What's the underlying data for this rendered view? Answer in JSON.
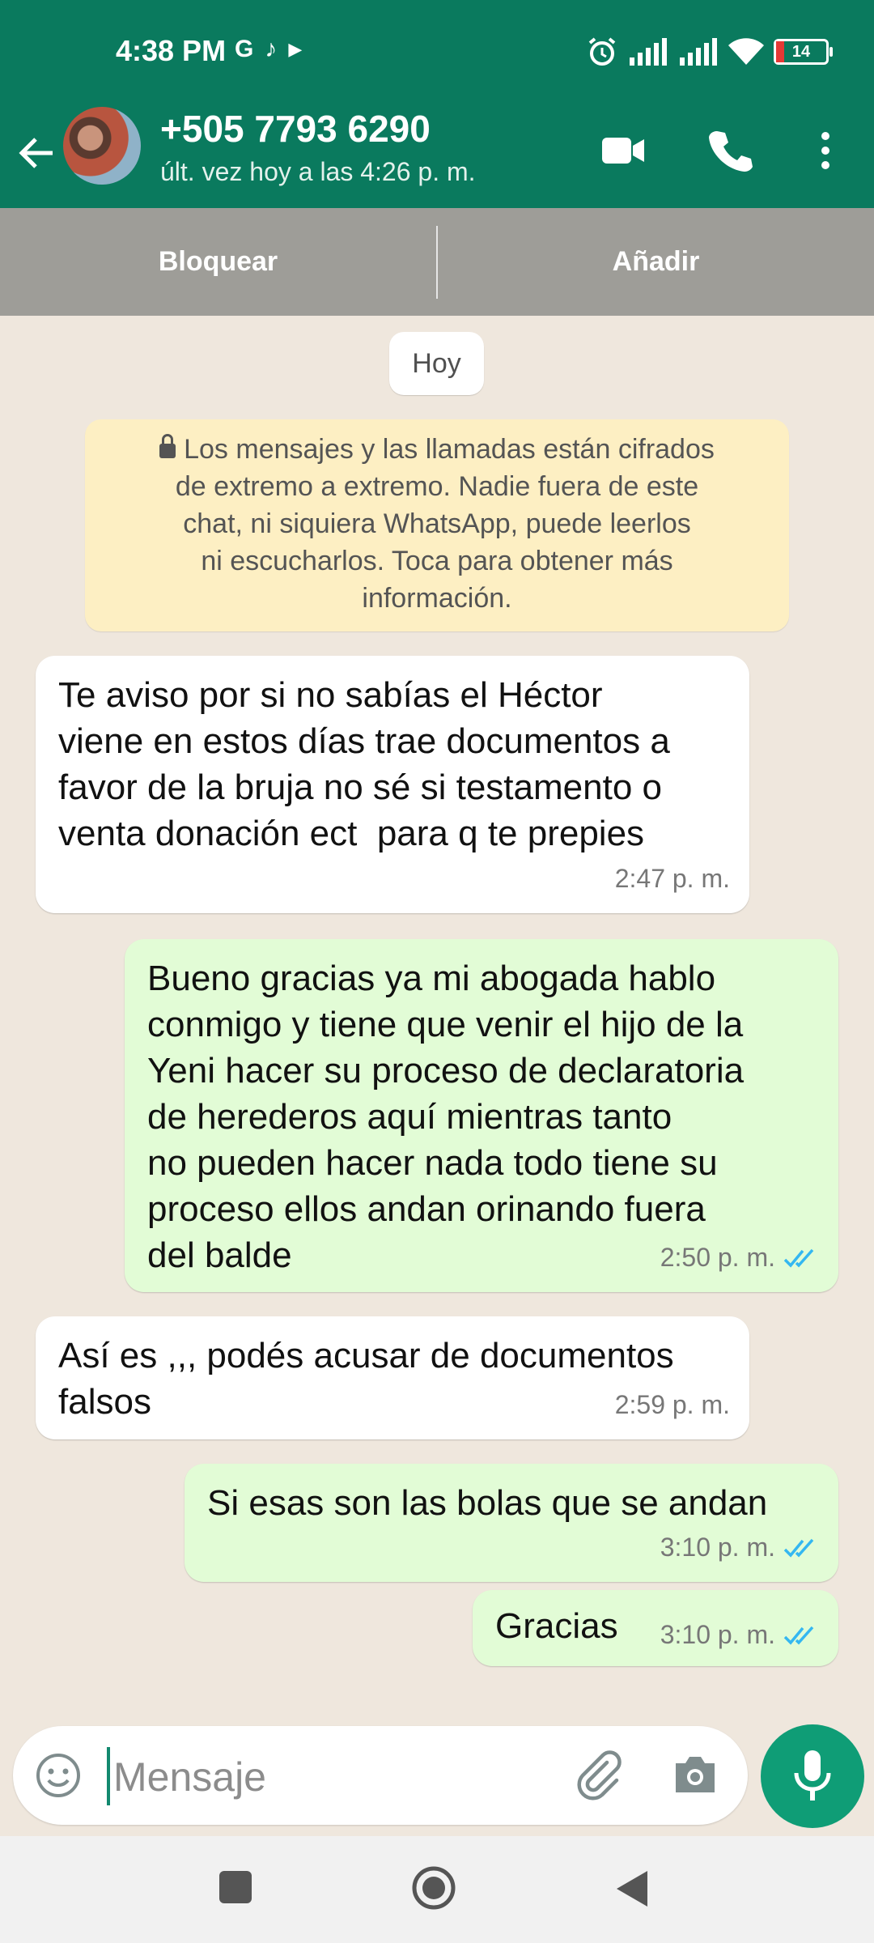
{
  "status_bar": {
    "time": "4:38 PM",
    "left_icons": [
      "google-icon",
      "tiktok-icon",
      "play-icon"
    ],
    "right_icons": [
      "alarm-icon",
      "signal-icon",
      "signal-icon",
      "wifi-icon",
      "battery-icon"
    ],
    "battery_level": "14"
  },
  "header": {
    "contact_name": "+505 7793 6290",
    "last_seen": "últ. vez hoy a las 4:26 p. m.",
    "icons": [
      "back-arrow-icon",
      "video-call-icon",
      "phone-icon",
      "more-vert-icon"
    ]
  },
  "actions": {
    "block": "Bloquear",
    "add": "Añadir"
  },
  "chat": {
    "day_label": "Hoy",
    "encryption_notice": {
      "line1": "Los mensajes y las llamadas están cifrados",
      "line2": "de extremo a extremo. Nadie fuera de este",
      "line3": "chat, ni siquiera WhatsApp, puede leerlos",
      "line4": "ni escucharlos. Toca para obtener más",
      "line5": "información."
    },
    "messages": [
      {
        "direction": "in",
        "text": "Te aviso por si no sabías el Héctor\nviene en estos días trae documentos a\nfavor de la bruja no sé si testamento o\nventa donación ect  para q te prepies",
        "time": "2:47 p. m."
      },
      {
        "direction": "out",
        "text": "Bueno gracias ya mi abogada hablo\nconmigo y tiene que venir el hijo de la\nYeni hacer su proceso de declaratoria\nde herederos aquí mientras tanto\nno pueden hacer nada todo tiene su\nproceso ellos andan orinando fuera\ndel balde",
        "time": "2:50 p. m.",
        "status": "read"
      },
      {
        "direction": "in",
        "text": "Así es ,,, podés acusar de documentos\nfalsos",
        "time": "2:59 p. m."
      },
      {
        "direction": "out",
        "text": "Si esas son las bolas que se andan",
        "time": "3:10 p. m.",
        "status": "read"
      },
      {
        "direction": "out",
        "text": "Gracias",
        "time": "3:10 p. m.",
        "status": "read"
      }
    ]
  },
  "composer": {
    "placeholder": "Mensaje",
    "icons": [
      "emoji-icon",
      "attach-icon",
      "camera-icon",
      "mic-icon"
    ]
  },
  "nav": {
    "icons": [
      "recents-square-icon",
      "home-circle-icon",
      "back-triangle-icon"
    ]
  },
  "colors": {
    "header_green": "#0a7a5e",
    "outgoing_bubble": "#e2fcd6",
    "incoming_bubble": "#ffffff",
    "read_tick": "#34b7f1",
    "notice_bg": "#fdefc3",
    "mic_button": "#0f9d76"
  }
}
